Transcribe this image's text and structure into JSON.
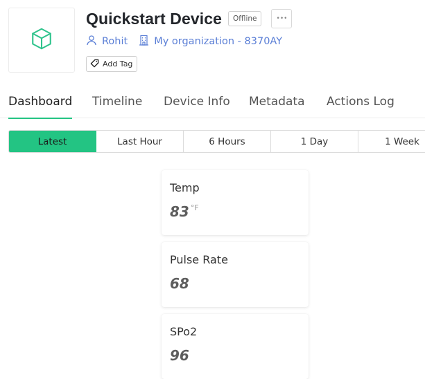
{
  "device": {
    "title": "Quickstart Device",
    "status": "Offline",
    "more": "•••",
    "owner": "Rohit",
    "organization": "My organization - 8370AY",
    "add_tag": "Add Tag"
  },
  "tabs": [
    {
      "label": "Dashboard",
      "active": true
    },
    {
      "label": "Timeline",
      "active": false
    },
    {
      "label": "Device Info",
      "active": false
    },
    {
      "label": "Metadata",
      "active": false
    },
    {
      "label": "Actions Log",
      "active": false
    }
  ],
  "time_ranges": [
    {
      "label": "Latest",
      "selected": true
    },
    {
      "label": "Last Hour",
      "selected": false
    },
    {
      "label": "6 Hours",
      "selected": false
    },
    {
      "label": "1 Day",
      "selected": false
    },
    {
      "label": "1 Week",
      "selected": false
    }
  ],
  "widgets": [
    {
      "label": "Temp",
      "value": "83",
      "unit": "°F"
    },
    {
      "label": "Pulse Rate",
      "value": "68",
      "unit": ""
    },
    {
      "label": "SPo2",
      "value": "96",
      "unit": ""
    }
  ],
  "colors": {
    "accent": "#23c483",
    "link": "#5b7fd6",
    "device_icon": "#2ec38c"
  },
  "icons": {
    "device": "cube-icon",
    "owner": "user-icon",
    "organization": "building-icon",
    "tag": "tag-icon"
  }
}
